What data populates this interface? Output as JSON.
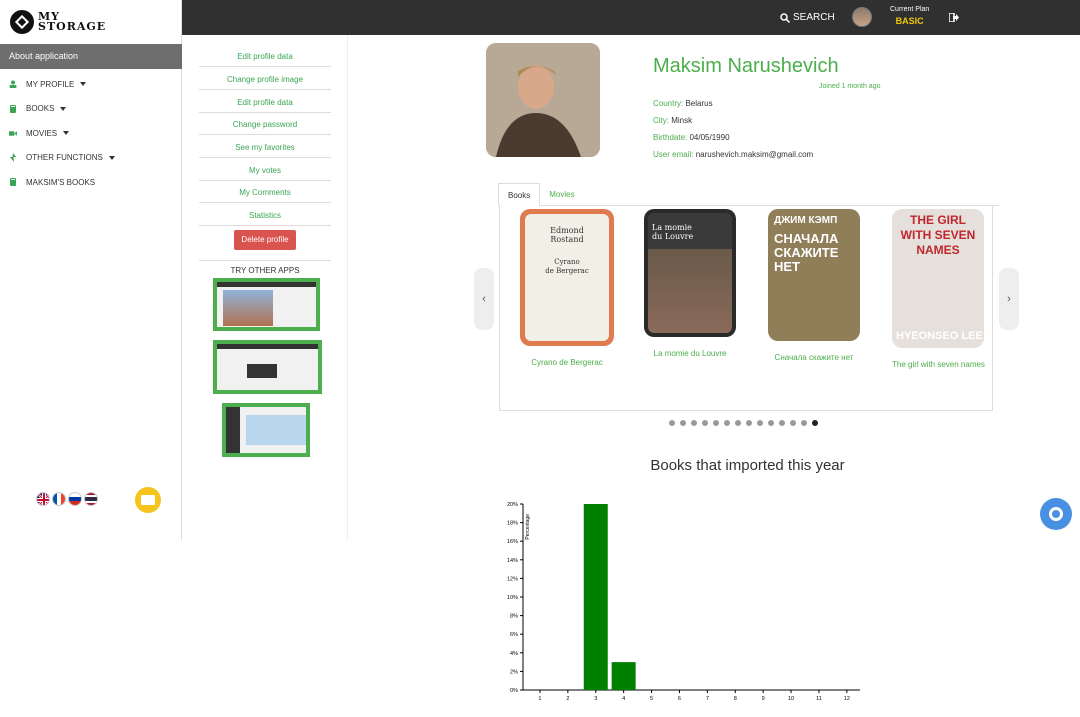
{
  "sidebar": {
    "about": "About application",
    "items": [
      {
        "label": "MY PROFILE",
        "icon": "user-icon",
        "caret": true
      },
      {
        "label": "BOOKS",
        "icon": "book-icon",
        "caret": true
      },
      {
        "label": "MOVIES",
        "icon": "video-camera-icon",
        "caret": true
      },
      {
        "label": "OTHER FUNCTIONS",
        "icon": "bolt-icon",
        "caret": true
      },
      {
        "label": "MAKSIM'S BOOKS",
        "icon": "book-icon",
        "caret": false
      }
    ],
    "languages": [
      "en",
      "fr",
      "ru",
      "th"
    ]
  },
  "topbar": {
    "search_label": "SEARCH",
    "plan_label": "Current Plan",
    "plan_value": "BASIC"
  },
  "profile_menu": {
    "links": [
      "Edit profile data",
      "Change profile image",
      "Edit profile data",
      "Change password",
      "See my favorites",
      "My votes",
      "My Comments",
      "Statistics"
    ],
    "delete_label": "Delete profile",
    "try_label": "TRY OTHER APPS"
  },
  "profile": {
    "name": "Maksim Narushevich",
    "joined": "Joined 1 month ago",
    "country_label": "Country:",
    "country": "Belarus",
    "city_label": "City:",
    "city": "Minsk",
    "birthdate_label": "Birthdate:",
    "birthdate": "04/05/1990",
    "email_label": "User email:",
    "email": "narushevich.maksim@gmail.com"
  },
  "tabs": [
    "Books",
    "Movies"
  ],
  "books": [
    {
      "title": "Cyrano de Bergerac",
      "cover_author": "Edmond\nRostand",
      "cover_title": "Cyrano\nde Bergerac"
    },
    {
      "title": "La momie du Louvre",
      "cover_title": "La momie\ndu Louvre"
    },
    {
      "title": "Сначала скажите нет",
      "cover_author": "ДЖИМ КЭМП",
      "cover_title": "СНАЧАЛА СКАЖИТЕ НЕТ"
    },
    {
      "title": "The girl with seven names",
      "cover_title": "THE GIRL WITH SEVEN NAMES",
      "cover_author": "HYEONSEO LEE"
    }
  ],
  "carousel": {
    "dot_count": 14,
    "active_dot": 13
  },
  "chart_title": "Books that imported this year",
  "chart_data": {
    "type": "bar",
    "categories": [
      "1",
      "2",
      "3",
      "4",
      "5",
      "6",
      "7",
      "8",
      "9",
      "10",
      "11",
      "12"
    ],
    "values": [
      0,
      0,
      20,
      3,
      0,
      0,
      0,
      0,
      0,
      0,
      0,
      0
    ],
    "ylabel": "Percentage",
    "yticks": [
      "0%",
      "2%",
      "4%",
      "6%",
      "8%",
      "10%",
      "12%",
      "14%",
      "16%",
      "18%",
      "20%"
    ],
    "ylim": [
      0,
      20
    ],
    "bar_color": "#008000"
  },
  "colors": {
    "accent": "#4cae4c",
    "topbar": "#303030",
    "danger": "#d9534f",
    "plan": "#f0c808"
  }
}
